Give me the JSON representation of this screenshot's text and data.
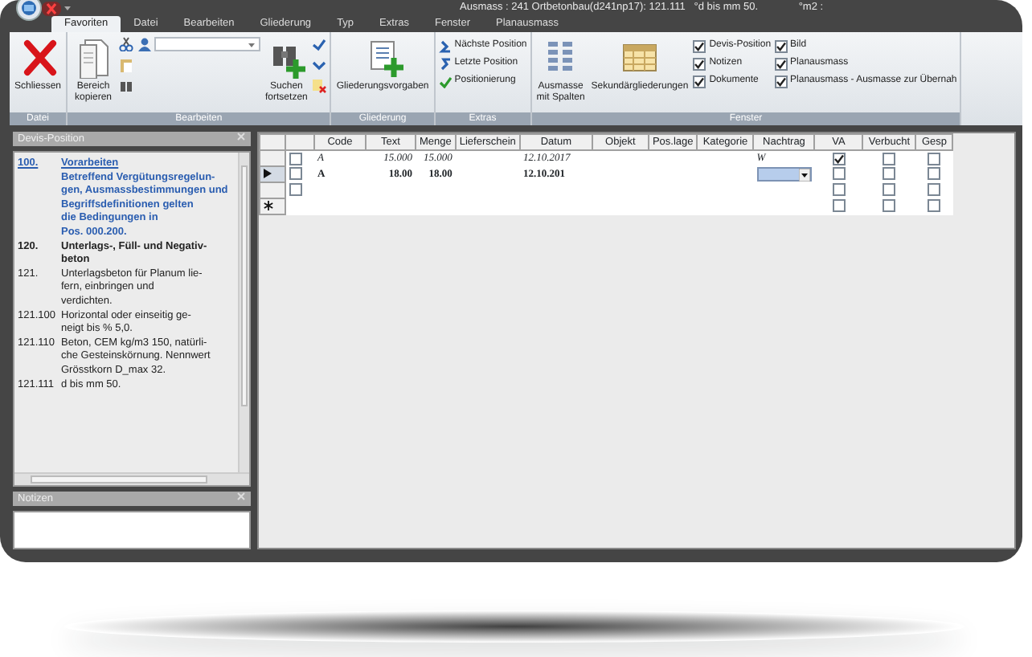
{
  "title_bar": {
    "title": "Ausmass : 241 Ortbetonbau(d241np17): 121.111   °d bis mm 50.              °m2 :"
  },
  "tabs": [
    {
      "label": "Favoriten",
      "selected": true
    },
    {
      "label": "Datei",
      "selected": false
    },
    {
      "label": "Bearbeiten",
      "selected": false
    },
    {
      "label": "Gliederung",
      "selected": false
    },
    {
      "label": "Typ",
      "selected": false
    },
    {
      "label": "Extras",
      "selected": false
    },
    {
      "label": "Fenster",
      "selected": false
    },
    {
      "label": "Planausmass",
      "selected": false
    }
  ],
  "ribbon": [
    {
      "label": "Datei",
      "items": [
        {
          "kind": "large",
          "label": "Schliessen"
        }
      ]
    },
    {
      "label": "Bearbeiten",
      "items": [
        {
          "kind": "large",
          "label": "Bereich\nkopieren"
        },
        {
          "kind": "tools"
        },
        {
          "kind": "combo"
        },
        {
          "kind": "large",
          "label": "Suchen\nfortsetzen"
        },
        {
          "kind": "marks"
        }
      ]
    },
    {
      "label": "Gliederung",
      "items": [
        {
          "kind": "large",
          "label": "Gliederungsvorgaben"
        }
      ]
    },
    {
      "label": "Extras",
      "items": [
        {
          "kind": "links",
          "entries": [
            "Nächste Position",
            "Letzte Position",
            "Positionierung"
          ]
        }
      ]
    },
    {
      "label": "Fenster",
      "items": [
        {
          "kind": "large",
          "label": "Ausmasse\nmit Spalten"
        },
        {
          "kind": "large",
          "label": "Sekundärgliederungen"
        },
        {
          "kind": "checks",
          "entries": [
            {
              "label": "Devis-Position",
              "checked": true
            },
            {
              "label": "Notizen",
              "checked": true
            },
            {
              "label": "Dokumente",
              "checked": true
            }
          ]
        },
        {
          "kind": "checks",
          "entries": [
            {
              "label": "Bild",
              "checked": true
            },
            {
              "label": "Planausmass",
              "checked": true
            },
            {
              "label": "Planausmass - Ausmasse zur Übernah",
              "checked": true
            }
          ]
        }
      ]
    }
  ],
  "devis_panel": {
    "title": "Devis-Position",
    "entries": [
      {
        "kind": "heading",
        "number": "100.",
        "lines": [
          "Vorarbeiten",
          "Betreffend Vergütungsregelun-",
          "gen, Ausmassbestimmungen und",
          "Begriffsdefinitionen gelten",
          "die Bedingungen in",
          "Pos. 000.200."
        ]
      },
      {
        "kind": "bold",
        "number": "120.",
        "lines": [
          "Unterlags-, Füll- und Negativ-",
          "beton"
        ]
      },
      {
        "kind": "normal",
        "number": "121.",
        "lines": [
          "Unterlagsbeton für Planum lie-",
          "fern, einbringen und",
          "verdichten."
        ]
      },
      {
        "kind": "normal",
        "number": "121.100",
        "lines": [
          "Horizontal oder einseitig ge-",
          "neigt bis % 5,0."
        ]
      },
      {
        "kind": "normal",
        "number": "121.110",
        "lines": [
          "Beton, CEM kg/m3 150, natürli-",
          "che Gesteinskörnung. Nennwert",
          "Grösstkorn D_max 32."
        ]
      },
      {
        "kind": "normal",
        "number": "121.111",
        "lines": [
          "d bis mm 50."
        ]
      }
    ]
  },
  "notes_panel": {
    "title": "Notizen"
  },
  "grid": {
    "columns": [
      "Code",
      "Text",
      "Menge",
      "Lieferschein",
      "Datum",
      "Objekt",
      "Pos.lage",
      "Kategorie",
      "Nachtrag",
      "VA",
      "Verbucht",
      "Gesp"
    ],
    "rows": [
      {
        "kind": "saved",
        "selected": false,
        "marked": false,
        "cells": [
          "A",
          "15.000",
          "15.000",
          null,
          "12.10.2017",
          null,
          null,
          null,
          "W"
        ],
        "va": true,
        "verbucht": false,
        "gesp": false
      },
      {
        "kind": "editing",
        "selected": true,
        "marked": false,
        "cells": [
          "A",
          "18.00",
          "18.00",
          null,
          "12.10.201",
          null,
          null,
          null,
          null
        ],
        "va": false,
        "verbucht": false,
        "gesp": false
      },
      {
        "kind": "blank",
        "selected": false,
        "marked": false,
        "cells": [
          null,
          null,
          null,
          null,
          null,
          null,
          null,
          null,
          null
        ],
        "va": false,
        "verbucht": false,
        "gesp": false
      },
      {
        "kind": "new",
        "selected": false,
        "cells": [
          null,
          null,
          null,
          null,
          null,
          null,
          null,
          null,
          null
        ],
        "va": false,
        "verbucht": false,
        "gesp": false
      }
    ]
  }
}
